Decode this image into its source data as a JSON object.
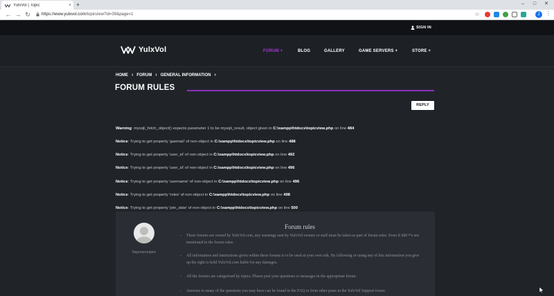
{
  "browser": {
    "tab_title": "YulxVol | Topic",
    "tab_close": "×",
    "new_tab": "+",
    "url_host": "https://www.yulxvol.com",
    "url_path": "/topicview?id=39&page=1",
    "win_min": "–",
    "win_max": "□",
    "win_close": "✕",
    "avatar_letter": "J",
    "menu": "⋮"
  },
  "site": {
    "signin": "SIGN IN",
    "logo_text": "YulxVol",
    "nav": {
      "forum": "FORUM +",
      "blog": "BLOG",
      "gallery": "GALLERY",
      "game_servers": "GAME SERVERS +",
      "store": "STORE +"
    },
    "accent": "#a43ad0"
  },
  "breadcrumb": {
    "home": "HOME",
    "forum": "FORUM",
    "section": "GENERAL INFORMATION",
    "sep": "›"
  },
  "page_title": "FORUM RULES",
  "reply_label": "REPLY",
  "messages": [
    {
      "level": "Warning",
      "text": ": mysqli_fetch_object() expects parameter 1 to be mysqli_result, object given in ",
      "file": "C:\\xampp\\htdocs\\topicview.php",
      "on_line": " on line ",
      "line": "484"
    },
    {
      "level": "Notice",
      "text": ": Trying to get property 'gaemail' of non-object in ",
      "file": "C:\\xampp\\htdocs\\topicview.php",
      "on_line": " on line ",
      "line": "488"
    },
    {
      "level": "Notice",
      "text": ": Trying to get property 'user_id' of non-object in ",
      "file": "C:\\xampp\\htdocs\\topicview.php",
      "on_line": " on line ",
      "line": "492"
    },
    {
      "level": "Notice",
      "text": ": Trying to get property 'user_id' of non-object in ",
      "file": "C:\\xampp\\htdocs\\topicview.php",
      "on_line": " on line ",
      "line": "496"
    },
    {
      "level": "Notice",
      "text": ": Trying to get property 'username' of non-object in ",
      "file": "C:\\xampp\\htdocs\\topicview.php",
      "on_line": " on line ",
      "line": "496"
    },
    {
      "level": "Notice",
      "text": ": Trying to get property 'roles' of non-object in ",
      "file": "C:\\xampp\\htdocs\\topicview.php",
      "on_line": " on line ",
      "line": "498"
    },
    {
      "level": "Notice",
      "text": ": Trying to get property 'join_date' of non-object in ",
      "file": "C:\\xampp\\htdocs\\topicview.php",
      "on_line": " on line ",
      "line": "500"
    }
  ],
  "post": {
    "username": "Nepnoeronpiex",
    "title": "Forum rules",
    "bullet": "-",
    "items": [
      "These forums are owned by YulxVol.com, any warnings sent by YulxVol owners or staff must be taken as part of forum rules. Even if itâ€™s not mentioned in the forum rules.",
      "All information and instructions given within these forums is to be used at your own risk. By following or using any of this information you give up the right to hold YulxVol.com liable for any damages.",
      "All the forums are categorised by topics.  Please post your questions or messages in the appropriate forum.",
      "Answers to many of the questions you may have can be found in the FAQ or from other posts in the YulxVol Support forum"
    ]
  }
}
